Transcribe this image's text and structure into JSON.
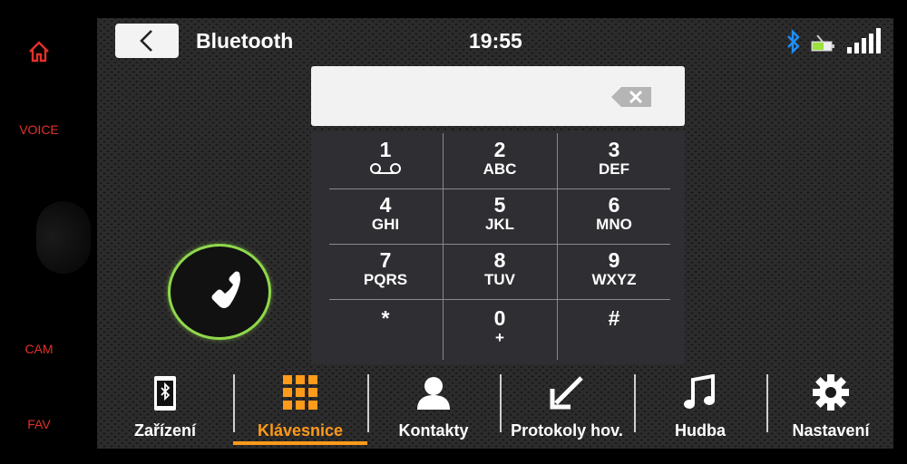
{
  "hardware_buttons": {
    "home_icon": "home-icon",
    "voice": "VOICE",
    "cam": "CAM",
    "fav": "FAV"
  },
  "status_bar": {
    "title": "Bluetooth",
    "time": "19:55",
    "icons": [
      "bluetooth-icon",
      "battery-icon",
      "signal-strength-icon"
    ]
  },
  "dialpad": {
    "number_value": "",
    "keys": [
      {
        "digit": "1",
        "letters": ""
      },
      {
        "digit": "2",
        "letters": "ABC"
      },
      {
        "digit": "3",
        "letters": "DEF"
      },
      {
        "digit": "4",
        "letters": "GHI"
      },
      {
        "digit": "5",
        "letters": "JKL"
      },
      {
        "digit": "6",
        "letters": "MNO"
      },
      {
        "digit": "7",
        "letters": "PQRS"
      },
      {
        "digit": "8",
        "letters": "TUV"
      },
      {
        "digit": "9",
        "letters": "WXYZ"
      },
      {
        "digit": "*",
        "letters": ""
      },
      {
        "digit": "0",
        "letters": "+"
      },
      {
        "digit": "#",
        "letters": ""
      }
    ]
  },
  "tabs": [
    {
      "label": "Zařízení",
      "icon": "phone-device-icon",
      "active": false
    },
    {
      "label": "Klávesnice",
      "icon": "keypad-icon",
      "active": true
    },
    {
      "label": "Kontakty",
      "icon": "contact-icon",
      "active": false
    },
    {
      "label": "Protokoly hov.",
      "icon": "call-log-icon",
      "active": false
    },
    {
      "label": "Hudba",
      "icon": "music-icon",
      "active": false
    },
    {
      "label": "Nastavení",
      "icon": "settings-icon",
      "active": false
    }
  ],
  "colors": {
    "accent": "#ff9a1a",
    "call_ring": "#8fd84b",
    "hardware_text": "#e2312a",
    "bluetooth": "#1e90ff"
  }
}
